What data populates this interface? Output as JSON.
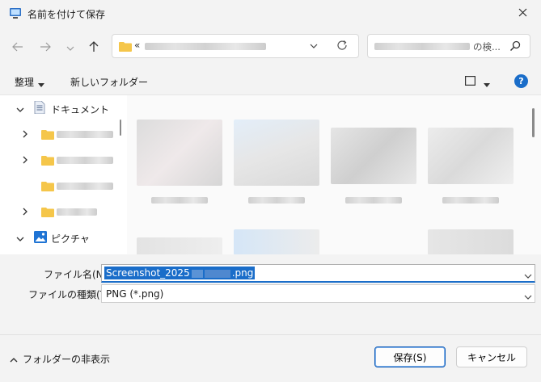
{
  "window": {
    "title": "名前を付けて保存"
  },
  "address": {
    "chevron": "«"
  },
  "search": {
    "placeholder": "の検..."
  },
  "toolbar": {
    "organize_label": "整理",
    "new_folder_label": "新しいフォルダー"
  },
  "sidebar": {
    "items": [
      {
        "label": "ドキュメント",
        "icon": "document-icon",
        "expanded": true
      },
      {
        "label": "",
        "icon": "folder-icon",
        "expanded": false
      },
      {
        "label": "",
        "icon": "folder-icon",
        "expanded": false
      },
      {
        "label": "",
        "icon": "folder-icon",
        "expanded": false
      },
      {
        "label": "",
        "icon": "folder-icon",
        "expanded": false
      },
      {
        "label": "ピクチャ",
        "icon": "pictures-icon",
        "expanded": true
      }
    ]
  },
  "form": {
    "filename_label": "ファイル名(N):",
    "filename_prefix": "Screenshot_2025",
    "filename_suffix": ".png",
    "filetype_label": "ファイルの種類(T):",
    "filetype_value": "PNG (*.png)"
  },
  "footer": {
    "hide_folders_label": "フォルダーの非表示",
    "save_label": "保存(S)",
    "cancel_label": "キャンセル"
  },
  "colors": {
    "accent": "#1a6dc9",
    "folder": "#f5c64a"
  }
}
